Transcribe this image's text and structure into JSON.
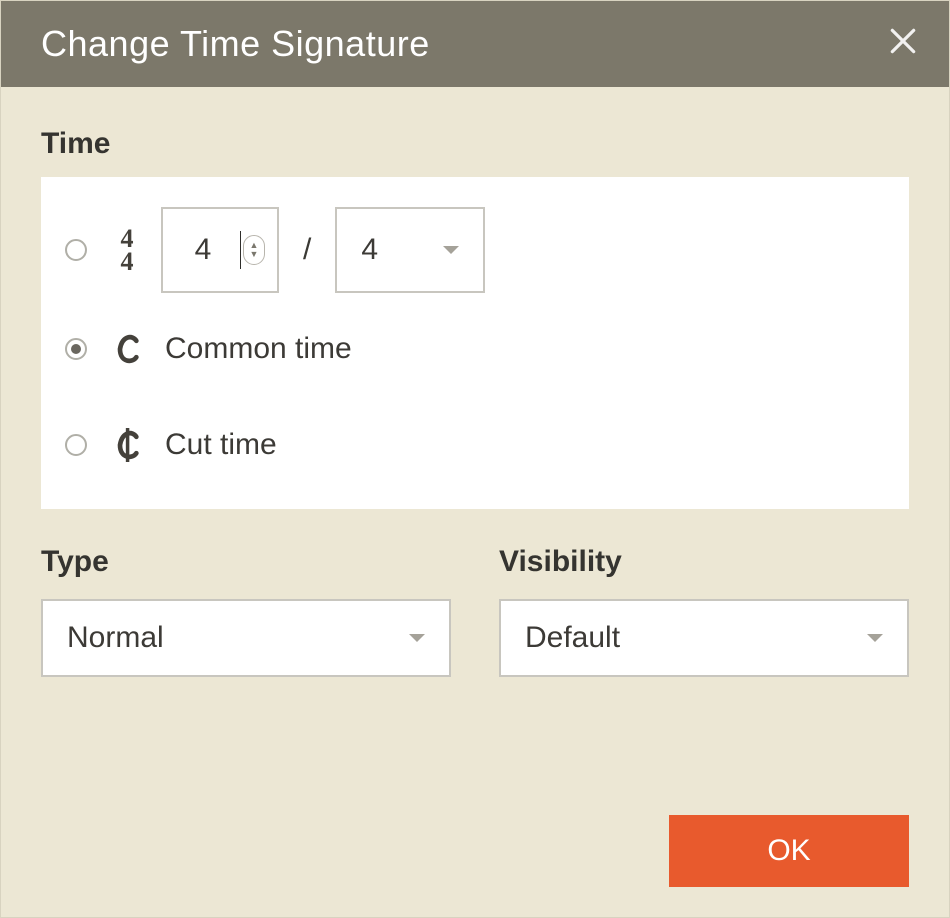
{
  "dialog": {
    "title": "Change Time Signature"
  },
  "sections": {
    "time": "Time",
    "type": "Type",
    "visibility": "Visibility"
  },
  "time_options": {
    "custom": {
      "numerator": "4",
      "denominator": "4",
      "icon_top": "4",
      "icon_bottom": "4",
      "separator": "/",
      "selected": false
    },
    "common": {
      "label": "Common time",
      "selected": true
    },
    "cut": {
      "label": "Cut time",
      "selected": false
    }
  },
  "type_select": {
    "value": "Normal"
  },
  "visibility_select": {
    "value": "Default"
  },
  "buttons": {
    "ok": "OK"
  }
}
